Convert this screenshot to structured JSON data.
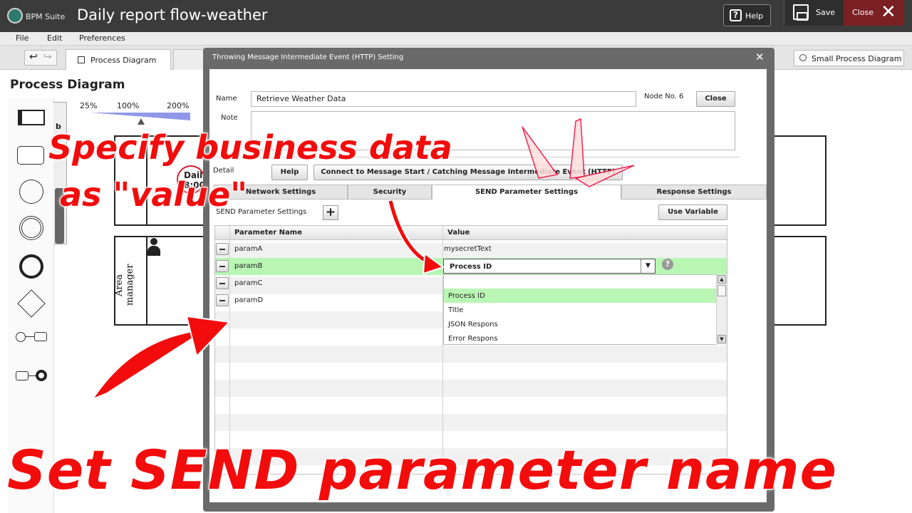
{
  "app": {
    "logo_text": "BPM Suite",
    "title": "Daily report flow-weather",
    "help_label": "Help",
    "save_label": "Save",
    "close_label": "Close"
  },
  "menu": [
    "File",
    "Edit",
    "Preferences"
  ],
  "tabs": {
    "process_diagram": "Process Diagram",
    "small_process_diagram": "Small Process Diagram"
  },
  "workspace": {
    "heading": "Process Diagram",
    "zoom_levels": [
      "25%",
      "100%",
      "200%"
    ],
    "lane2_label": "Area manager",
    "daily_node": "Daily 8:00"
  },
  "dialog": {
    "title": "Throwing Message Intermediate Event (HTTP) Setting",
    "name_label": "Name",
    "name_value": "Retrieve Weather Data",
    "node_no": "Node No. 6",
    "close_button": "Close",
    "note_label": "Note",
    "detail_label": "Detail",
    "help_button": "Help",
    "connect_button": "Connect to Message Start / Catching Message Intermediate Event (HTTP)",
    "tabs": [
      "Network Settings",
      "Security",
      "SEND Parameter Settings",
      "Response Settings"
    ],
    "send_settings_label": "SEND Parameter Settings",
    "use_variable_button": "Use Variable",
    "columns": [
      "Parameter Name",
      "Value"
    ],
    "rows": [
      {
        "name": "paramA",
        "value": "mysecretText"
      },
      {
        "name": "paramB",
        "value": "Process ID"
      },
      {
        "name": "paramC",
        "value": ""
      },
      {
        "name": "paramD",
        "value": ""
      }
    ],
    "dropdown_options": [
      "Process ID",
      "Title",
      "JSON Respons",
      "Error Respons"
    ]
  },
  "annotations": {
    "line1": "Specify business data",
    "line2": "as \"value\"",
    "bottom": "Set SEND parameter name"
  },
  "colors": {
    "titlebar": "#3b3b3b",
    "close_button": "#7a1f22",
    "selected_row": "#b9f6b4",
    "annotation_red": "#f20c0c"
  }
}
